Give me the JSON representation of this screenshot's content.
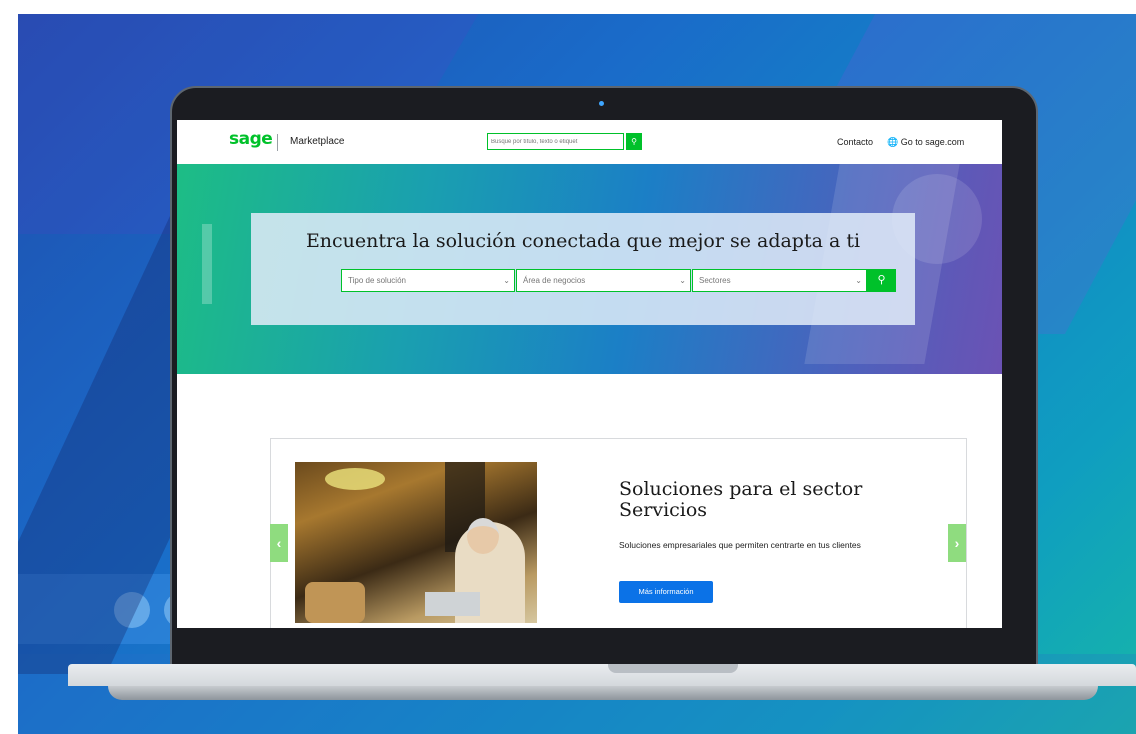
{
  "header": {
    "logo": "sage",
    "brand": "Marketplace",
    "search_placeholder": "Busque por título, texto o etiquet",
    "contact": "Contacto",
    "go_to": "Go to sage.com"
  },
  "hero": {
    "title": "Encuentra la solución conectada que mejor se adapta a ti",
    "filters": {
      "solution_type": "Tipo de solución",
      "business_area": "Área de negocios",
      "sectors": "Sectores"
    }
  },
  "carousel": {
    "title": "Soluciones para el sector Servicios",
    "description": "Soluciones empresariales que permiten centrarte en tus clientes",
    "button": "Más información",
    "prev": "‹",
    "next": "›"
  },
  "icons": {
    "search": "search-icon",
    "globe": "globe-icon",
    "chevron": "chevron-down-icon"
  },
  "colors": {
    "sage_green": "#00c12a",
    "button_blue": "#0b72e7",
    "arrow_green": "#8fdc7f"
  }
}
